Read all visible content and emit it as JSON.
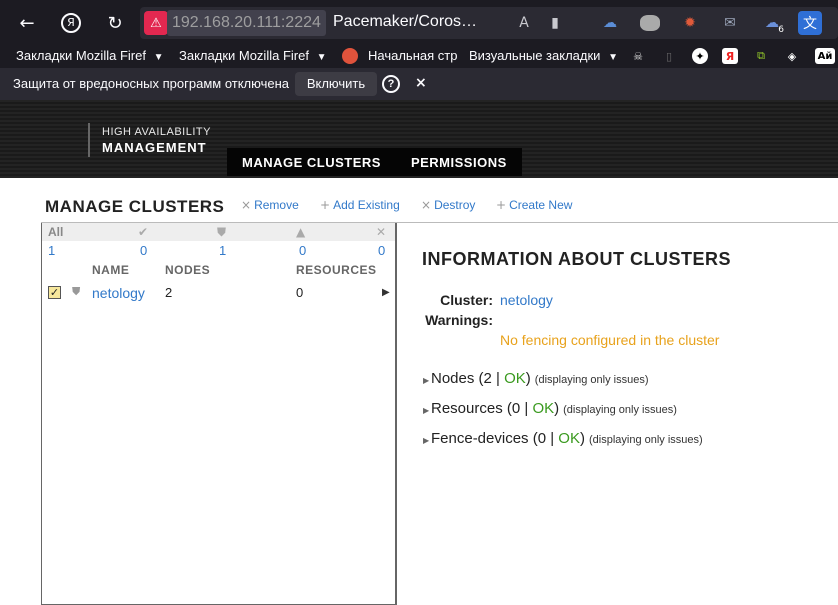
{
  "browser": {
    "url": "192.168.20.111:2224",
    "tab_title": "Pacemaker/Coros…",
    "icons": [
      "back-arrow-icon",
      "yandex-icon",
      "reload-icon",
      "insecure-connection-icon",
      "translate-icon",
      "bookmark-star-icon",
      "ext-cloud-icon",
      "ext-shape-icon",
      "ext-bug-icon",
      "ext-mail-icon",
      "ext-weather-icon",
      "ext-translate-icon"
    ],
    "weather_badge": "6"
  },
  "bookmarks": {
    "items": [
      {
        "label": "Закладки Mozilla Firef",
        "has_menu": true
      },
      {
        "label": "Закладки Mozilla Firef",
        "has_menu": true
      },
      {
        "label": "Начальная стр",
        "has_menu": false
      },
      {
        "label": "Визуальные закладки",
        "has_menu": true
      }
    ],
    "icons": [
      "firefox-icon",
      "skull-icon",
      "document-icon",
      "compass-icon",
      "yandex-bookmark-icon",
      "puzzle-icon",
      "diamond-icon",
      "avito-icon"
    ],
    "last_label": "Ай"
  },
  "notice": {
    "text": "Защита от вредоносных программ отключена",
    "button": "Включить",
    "help": "?",
    "close": "×"
  },
  "header": {
    "brand_top": "HIGH AVAILABILITY",
    "brand_bottom": "MANAGEMENT",
    "nav": [
      "MANAGE CLUSTERS",
      "PERMISSIONS"
    ]
  },
  "page": {
    "title": "MANAGE CLUSTERS",
    "actions": [
      {
        "symbol": "×",
        "label": "Remove"
      },
      {
        "symbol": "+",
        "label": "Add Existing"
      },
      {
        "symbol": "×",
        "label": "Destroy"
      },
      {
        "symbol": "+",
        "label": "Create New"
      }
    ]
  },
  "list": {
    "filter_all": "All",
    "counts": [
      "1",
      "0",
      "1",
      "0",
      "0"
    ],
    "columns": {
      "name": "NAME",
      "nodes": "NODES",
      "resources": "RESOURCES"
    },
    "rows": [
      {
        "checked": true,
        "name": "netology",
        "nodes": "2",
        "resources": "0"
      }
    ]
  },
  "info": {
    "title": "INFORMATION ABOUT CLUSTERS",
    "cluster_label": "Cluster:",
    "cluster_value": "netology",
    "warnings_label": "Warnings:",
    "warning_text": "No fencing configured in the cluster",
    "colors": {
      "link": "#3279c9",
      "warning": "#e8a21c",
      "ok": "#3a9a1f"
    },
    "sections": [
      {
        "name": "Nodes",
        "count": "2",
        "status": "OK",
        "note": "(displaying only issues)"
      },
      {
        "name": "Resources",
        "count": "0",
        "status": "OK",
        "note": "(displaying only issues)"
      },
      {
        "name": "Fence-devices",
        "count": "0",
        "status": "OK",
        "note": "(displaying only issues)"
      }
    ]
  }
}
